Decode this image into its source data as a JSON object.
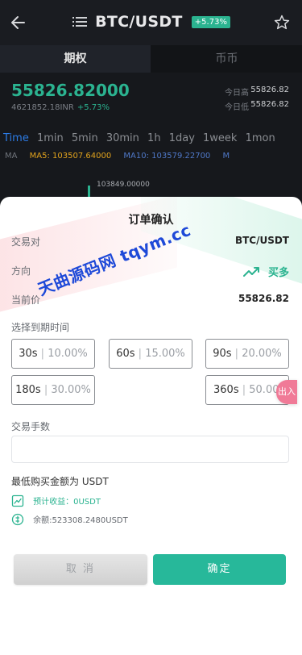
{
  "header": {
    "pair": "BTC/USDT",
    "change_badge": "+5.73%"
  },
  "mode_tabs": [
    "期权",
    "币币"
  ],
  "ticker": {
    "price": "55826.82000",
    "inr_value": "4621852.18INR",
    "change_pct": "+5.73%",
    "high_label": "今日高",
    "high_value": "55826.82",
    "low_label": "今日低",
    "low_value": "55826.82"
  },
  "timeframes": [
    "Time",
    "1min",
    "5min",
    "30min",
    "1h",
    "1day",
    "1week",
    "1mon"
  ],
  "ma_row": {
    "ma": "MA",
    "ma5": "MA5: 103507.64000",
    "ma10": "MA10: 103579.22700",
    "m": "M"
  },
  "chart_peak": "103849.00000",
  "modal": {
    "title": "订单确认",
    "pair_label": "交易对",
    "pair_value": "BTC/USDT",
    "direction_label": "方向",
    "direction_value": "买多",
    "price_label": "当前价",
    "price_value": "55826.82",
    "expiry_label": "选择到期时间",
    "periods": [
      {
        "time": "30s",
        "rate": "10.00%"
      },
      {
        "time": "60s",
        "rate": "15.00%"
      },
      {
        "time": "90s",
        "rate": "20.00%"
      },
      {
        "time": "180s",
        "rate": "30.00%"
      },
      {
        "time": "360s",
        "rate": "50.00"
      }
    ],
    "separator": "|",
    "fee_label": "交易手数",
    "min_amount": "最低购买金额为 USDT",
    "expected_profit": "预计收益：0USDT",
    "balance": "余额:523308.2480USDT",
    "cancel_label": "取 消",
    "confirm_label": "确定"
  },
  "float_badge": "出入",
  "watermark": "天曲源码网 tqym.cc",
  "colors": {
    "accent_green": "#2bb390",
    "confirm_green": "#27b89a",
    "watermark_blue": "#1e49d8"
  }
}
